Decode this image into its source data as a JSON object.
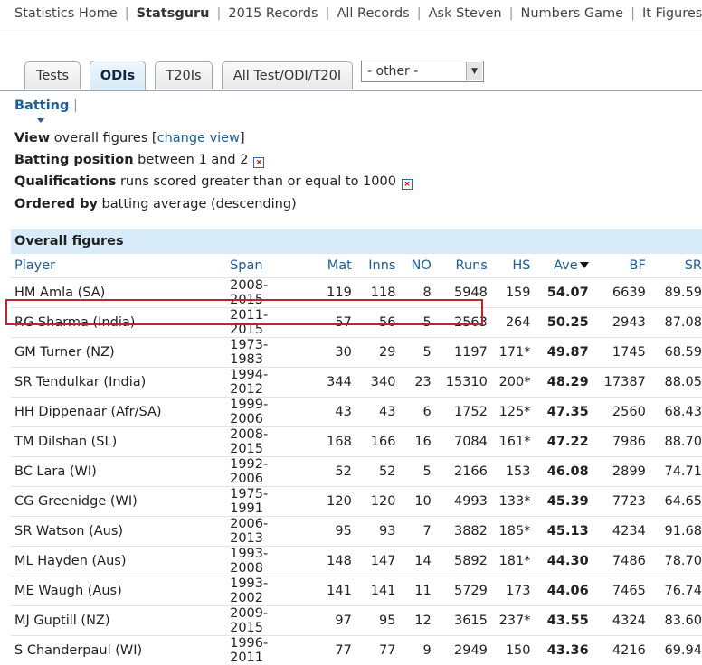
{
  "topnav": [
    "Statistics Home",
    "Statsguru",
    "2015 Records",
    "All Records",
    "Ask Steven",
    "Numbers Game",
    "It Figures"
  ],
  "tabs": {
    "tests": "Tests",
    "odis": "ODIs",
    "t20is": "T20Is",
    "all": "All Test/ODI/T20I",
    "other_select": "- other -"
  },
  "batting_label": "Batting",
  "query": {
    "view_label": "View",
    "view_text": "overall figures [",
    "view_link": "change view",
    "view_end": "]",
    "position_label": "Batting position",
    "position_text": "between 1 and 2",
    "qual_label": "Qualifications",
    "qual_text": "runs scored greater than or equal to 1000",
    "order_label": "Ordered by",
    "order_text": "batting average (descending)"
  },
  "table": {
    "heading": "Overall figures",
    "columns": [
      "Player",
      "Span",
      "Mat",
      "Inns",
      "NO",
      "Runs",
      "HS",
      "Ave",
      "BF",
      "SR"
    ],
    "rows": [
      [
        "HM Amla (SA)",
        "2008-2015",
        "119",
        "118",
        "8",
        "5948",
        "159",
        "54.07",
        "6639",
        "89.59"
      ],
      [
        "RG Sharma (India)",
        "2011-2015",
        "57",
        "56",
        "5",
        "2563",
        "264",
        "50.25",
        "2943",
        "87.08"
      ],
      [
        "GM Turner (NZ)",
        "1973-1983",
        "30",
        "29",
        "5",
        "1197",
        "171*",
        "49.87",
        "1745",
        "68.59"
      ],
      [
        "SR Tendulkar (India)",
        "1994-2012",
        "344",
        "340",
        "23",
        "15310",
        "200*",
        "48.29",
        "17387",
        "88.05"
      ],
      [
        "HH Dippenaar (Afr/SA)",
        "1999-2006",
        "43",
        "43",
        "6",
        "1752",
        "125*",
        "47.35",
        "2560",
        "68.43"
      ],
      [
        "TM Dilshan (SL)",
        "2008-2015",
        "168",
        "166",
        "16",
        "7084",
        "161*",
        "47.22",
        "7986",
        "88.70"
      ],
      [
        "BC Lara (WI)",
        "1992-2006",
        "52",
        "52",
        "5",
        "2166",
        "153",
        "46.08",
        "2899",
        "74.71"
      ],
      [
        "CG Greenidge (WI)",
        "1975-1991",
        "120",
        "120",
        "10",
        "4993",
        "133*",
        "45.39",
        "7723",
        "64.65"
      ],
      [
        "SR Watson (Aus)",
        "2006-2013",
        "95",
        "93",
        "7",
        "3882",
        "185*",
        "45.13",
        "4234",
        "91.68"
      ],
      [
        "ML Hayden (Aus)",
        "1993-2008",
        "148",
        "147",
        "14",
        "5892",
        "181*",
        "44.30",
        "7486",
        "78.70"
      ],
      [
        "ME Waugh (Aus)",
        "1993-2002",
        "141",
        "141",
        "11",
        "5729",
        "173",
        "44.06",
        "7465",
        "76.74"
      ],
      [
        "MJ Guptill (NZ)",
        "2009-2015",
        "97",
        "95",
        "12",
        "3615",
        "237*",
        "43.55",
        "4324",
        "83.60"
      ],
      [
        "S Chanderpaul (WI)",
        "1996-2011",
        "77",
        "77",
        "9",
        "2949",
        "150",
        "43.36",
        "4216",
        "69.94"
      ]
    ]
  },
  "highlight_color": "#c0232e",
  "accent_color": "#1a5d9a"
}
